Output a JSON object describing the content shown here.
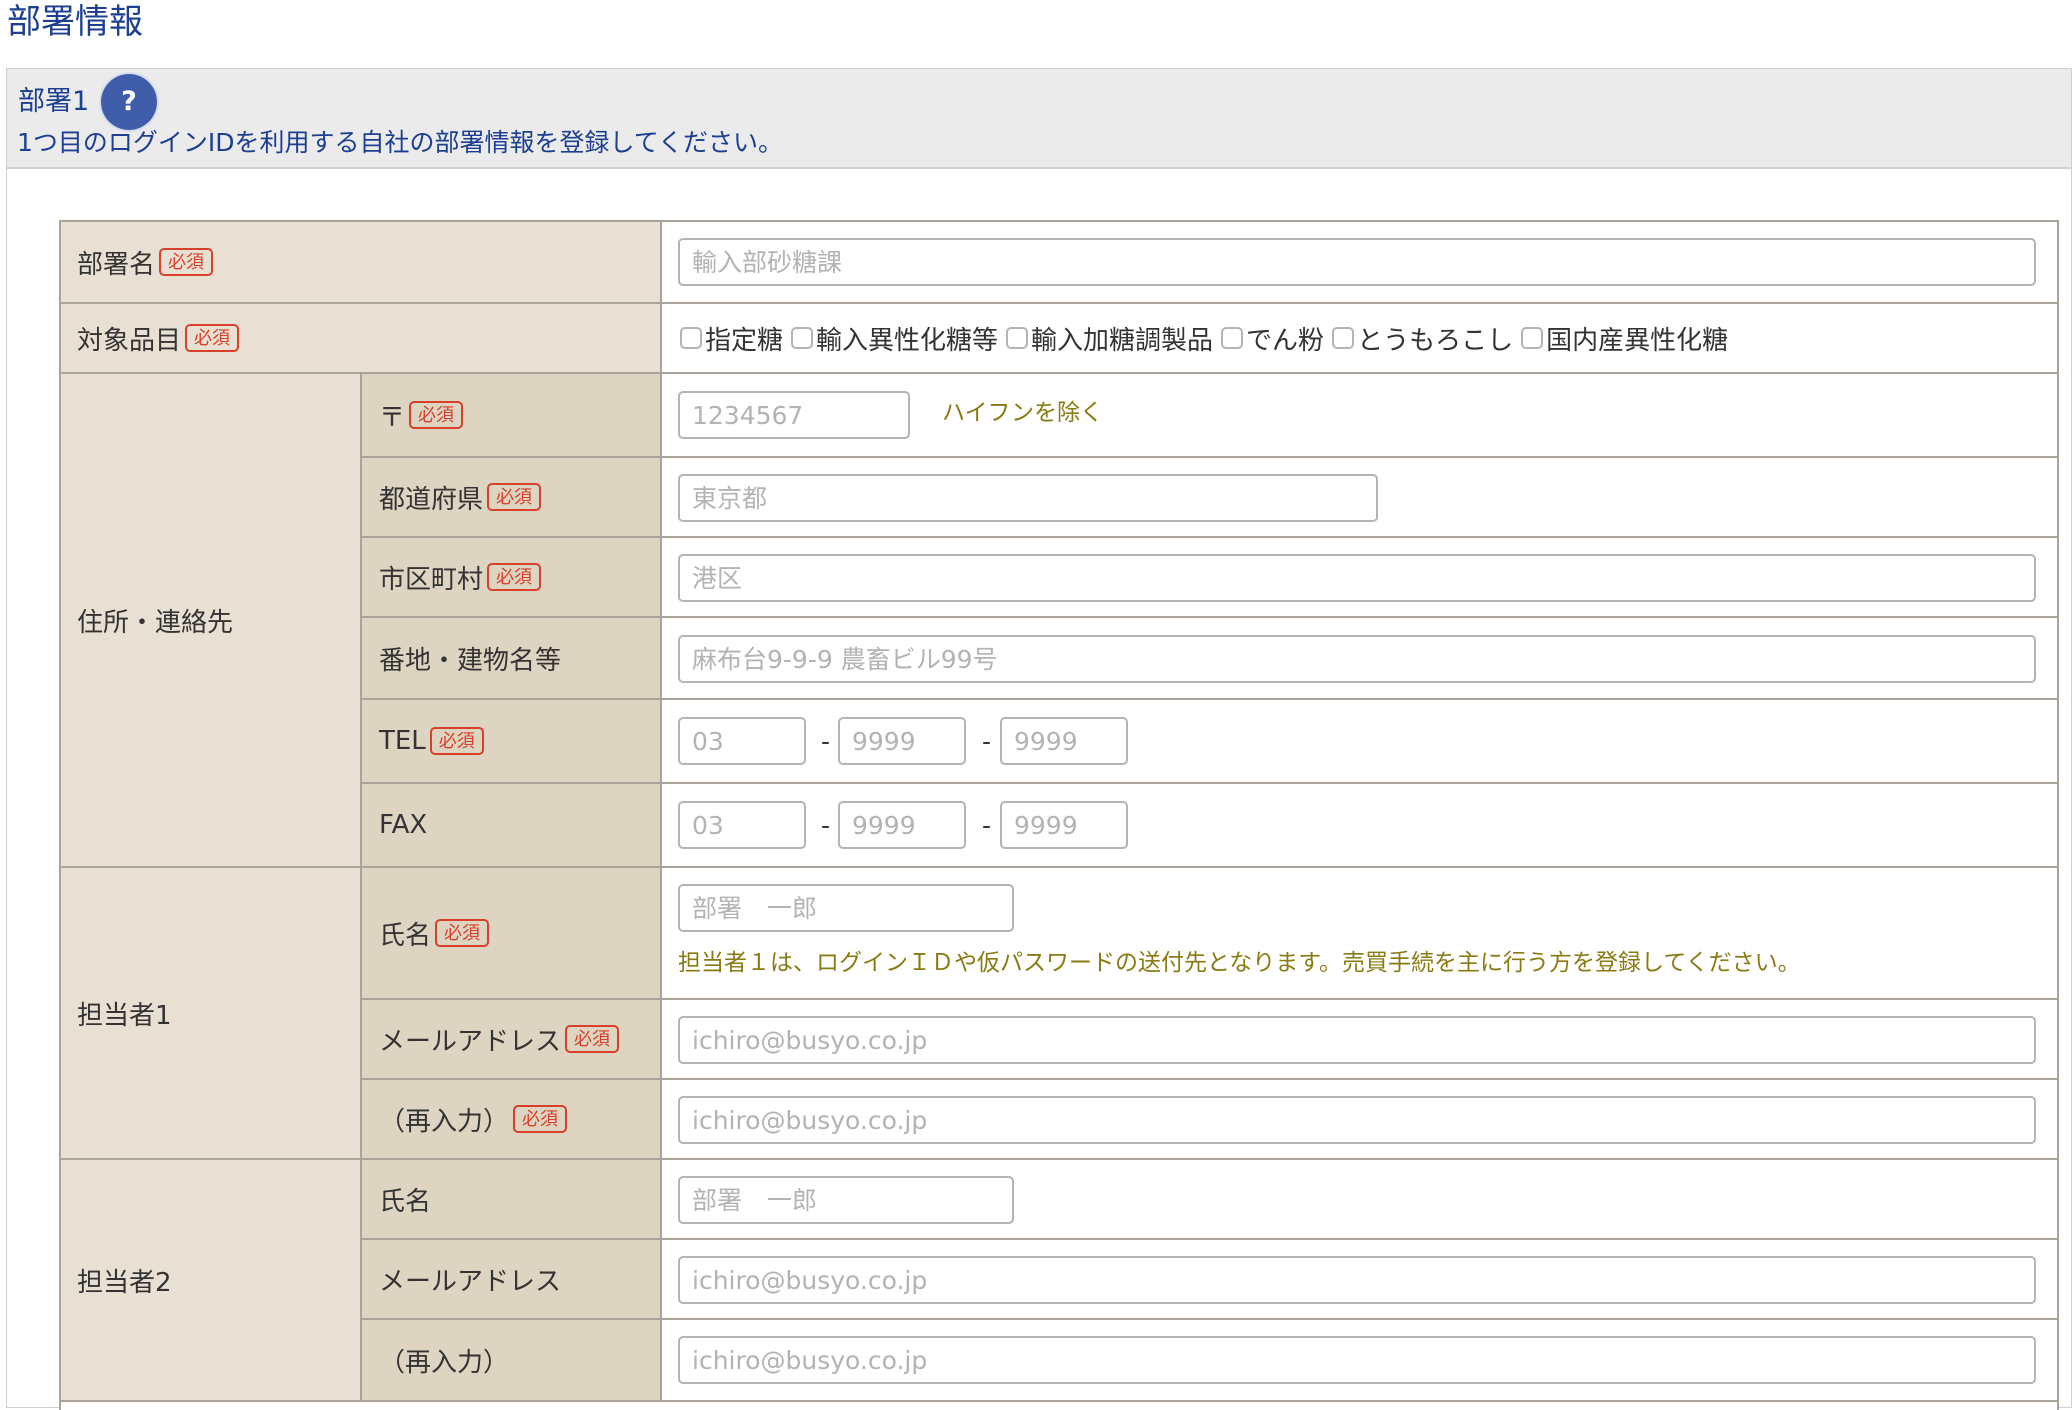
{
  "page_title": "部署情報",
  "section": {
    "title": "部署1",
    "help_icon_glyph": "?",
    "description": "1つ目のログインIDを利用する自社の部署情報を登録してください。"
  },
  "required_badge": "必須",
  "dash": "-",
  "form": {
    "department_name": {
      "label": "部署名",
      "placeholder": "輸入部砂糖課"
    },
    "target_items": {
      "label": "対象品目",
      "options": [
        "指定糖",
        "輸入異性化糖等",
        "輸入加糖調製品",
        "でん粉",
        "とうもろこし",
        "国内産異性化糖"
      ]
    },
    "address": {
      "group_label": "住所・連絡先",
      "postal": {
        "label": "〒",
        "placeholder": "1234567",
        "hint": "ハイフンを除く"
      },
      "prefecture": {
        "label": "都道府県",
        "placeholder": "東京都"
      },
      "city": {
        "label": "市区町村",
        "placeholder": "港区"
      },
      "street": {
        "label": "番地・建物名等",
        "placeholder": "麻布台9-9-9 農畜ビル99号"
      },
      "tel": {
        "label": "TEL",
        "placeholders": [
          "03",
          "9999",
          "9999"
        ]
      },
      "fax": {
        "label": "FAX",
        "placeholders": [
          "03",
          "9999",
          "9999"
        ]
      }
    },
    "contact1": {
      "group_label": "担当者1",
      "name": {
        "label": "氏名",
        "placeholder": "部署　一郎",
        "hint": "担当者１は、ログインＩＤや仮パスワードの送付先となります。売買手続を主に行う方を登録してください。"
      },
      "email": {
        "label": "メールアドレス",
        "placeholder": "ichiro@busyo.co.jp"
      },
      "email_confirm": {
        "label": "（再入力）",
        "placeholder": "ichiro@busyo.co.jp"
      }
    },
    "contact2": {
      "group_label": "担当者2",
      "name": {
        "label": "氏名",
        "placeholder": "部署　一郎"
      },
      "email": {
        "label": "メールアドレス",
        "placeholder": "ichiro@busyo.co.jp"
      },
      "email_confirm": {
        "label": "（再入力）",
        "placeholder": "ichiro@busyo.co.jp"
      }
    }
  },
  "colors": {
    "heading_blue": "#1c3f91",
    "label_primary_bg": "#e8e1d3",
    "label_secondary_bg": "#ddd4c2",
    "required_red": "#d9402b",
    "hint_olive": "#8a7a12",
    "help_icon_bg": "#3f5da8"
  }
}
